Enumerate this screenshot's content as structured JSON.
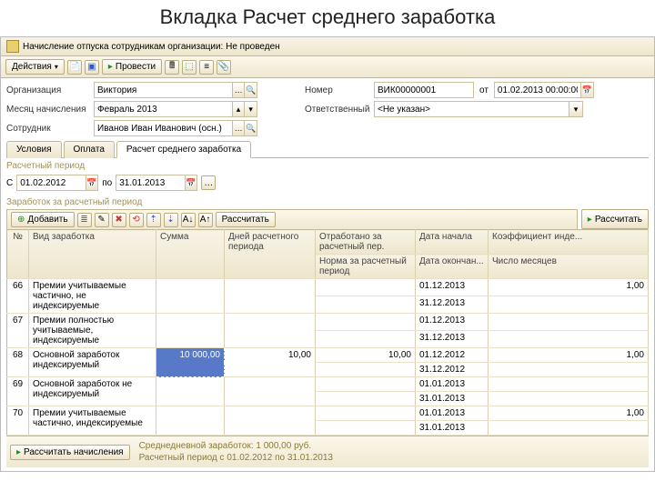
{
  "page_title": "Вкладка Расчет среднего заработка",
  "window_title": "Начисление отпуска сотрудникам организации: Не проведен",
  "toolbar": {
    "actions": "Действия",
    "provesti": "Провести"
  },
  "form": {
    "org_label": "Организация",
    "org_value": "Виктория",
    "month_label": "Месяц начисления",
    "month_value": "Февраль 2013",
    "emp_label": "Сотрудник",
    "emp_value": "Иванов Иван Иванович (осн.)",
    "number_label": "Номер",
    "number_value": "ВИК00000001",
    "date_label": "от",
    "date_value": "01.02.2013 00:00:00",
    "resp_label": "Ответственный",
    "resp_value": "<Не указан>"
  },
  "tabs": {
    "t1": "Условия",
    "t2": "Оплата",
    "t3": "Расчет среднего заработка"
  },
  "period": {
    "section": "Расчетный период",
    "from_label": "С",
    "from_value": "01.02.2012",
    "to_label": "по",
    "to_value": "31.01.2013"
  },
  "earnings_section": "Заработок за расчетный период",
  "subtb": {
    "add": "Добавить",
    "calc": "Рассчитать",
    "recalc_nach": "Рассчитать начисления",
    "recalc": "Рассчитать"
  },
  "headers": {
    "n": "№",
    "type": "Вид заработка",
    "sum": "Сумма",
    "days_rp": "Дней расчетного периода",
    "otr": "Отработано за расчетный пер.",
    "norm": "Норма за расчетный период",
    "date_start": "Дата начала",
    "date_end": "Дата окончан...",
    "coef": "Коэффициент инде...",
    "months": "Число месяцев"
  },
  "rows": [
    {
      "n": "66",
      "type": "Премии учитываемые частично, не индексируемые",
      "date1": "01.12.2013",
      "date2": "31.12.2013",
      "coef": "1,00"
    },
    {
      "n": "67",
      "type": "Премии полностью учитываемые, индексируемые",
      "date1": "01.12.2013",
      "date2": "31.12.2013"
    },
    {
      "n": "68",
      "type": "Основной заработок индексируемый",
      "sum": "10 000,00",
      "days": "10,00",
      "otr": "10,00",
      "date1": "01.12.2012",
      "date2": "31.12.2012",
      "coef": "1,00"
    },
    {
      "n": "69",
      "type": "Основной заработок не индексируемый",
      "date1": "01.01.2013",
      "date2": "31.01.2013"
    },
    {
      "n": "70",
      "type": "Премии учитываемые частично, индексируемые",
      "date1": "01.01.2013",
      "date2": "31.01.2013",
      "coef": "1,00"
    }
  ],
  "summary": {
    "line1": "Среднедневной заработок: 1 000,00 руб.",
    "line2": "Расчетный период с 01.02.2012 по 31.01.2013"
  }
}
